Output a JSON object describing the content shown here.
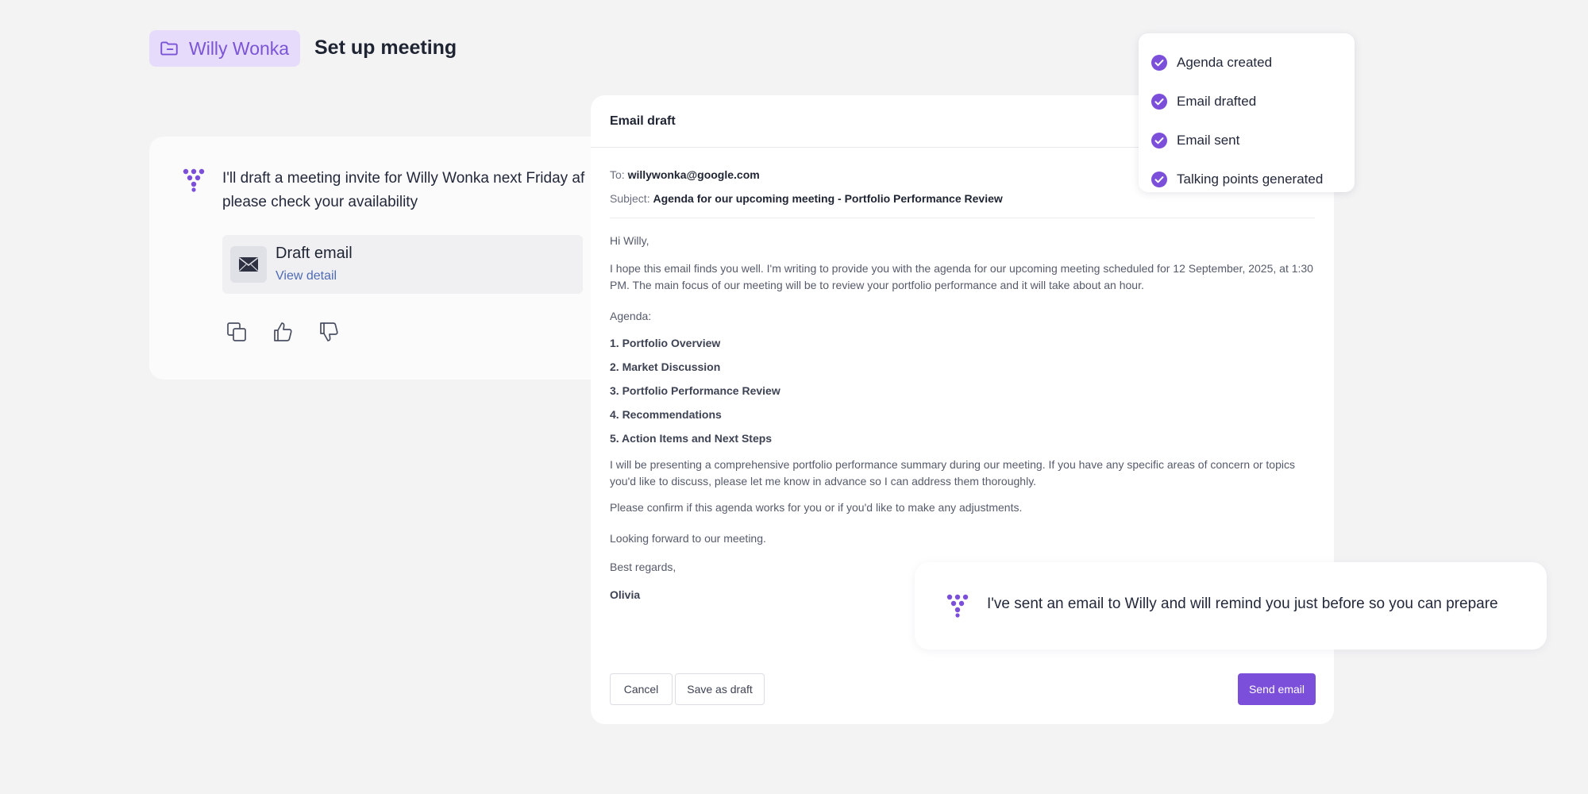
{
  "header": {
    "client_name": "Willy Wonka",
    "page_title": "Set up meeting"
  },
  "chat": {
    "message_line1": "I'll draft a meeting invite for Willy Wonka next Friday af",
    "message_line2": "please check your availability",
    "attachment": {
      "title": "Draft email",
      "link": "View detail",
      "icon": "envelope-icon"
    },
    "actions": [
      "copy-icon",
      "thumbs-up-icon",
      "thumbs-down-icon"
    ]
  },
  "email": {
    "panel_title": "Email draft",
    "to_label": "To:",
    "to_value": "willywonka@google.com",
    "subject_label": "Subject:",
    "subject_value": "Agenda for our upcoming meeting - Portfolio Performance Review",
    "greeting": "Hi Willy,",
    "intro": "I hope this email finds you well. I'm writing to provide you with the agenda for our upcoming meeting scheduled for 12 September, 2025, at 1:30 PM. The main focus of our meeting will be to review your portfolio performance and it will take about an hour.",
    "agenda_label": "Agenda:",
    "agenda_items": [
      "1. Portfolio Overview",
      "2. Market Discussion",
      "3. Portfolio Performance Review",
      "4. Recommendations",
      "5. Action Items and Next Steps"
    ],
    "paragraph2": "I will be presenting a comprehensive portfolio performance summary during our meeting. If you have any specific areas of concern or topics you'd like to discuss, please let me know in advance so I can address them thoroughly.",
    "paragraph3": "Please confirm if this agenda works for you or if you'd like to make any adjustments.",
    "closing": "Looking forward to our meeting.",
    "regards": "Best regards,",
    "signature": "Olivia",
    "buttons": {
      "cancel": "Cancel",
      "save_draft": "Save as draft",
      "send": "Send email"
    }
  },
  "status": {
    "items": [
      "Agenda created",
      "Email drafted",
      "Email sent",
      "Talking points generated"
    ]
  },
  "toast": {
    "message": "I've sent an email to Willy and will remind you just before so you can prepare"
  },
  "colors": {
    "accent": "#7b4fd9",
    "accent_light": "#e6dbfb",
    "background": "#f3f3f4"
  }
}
